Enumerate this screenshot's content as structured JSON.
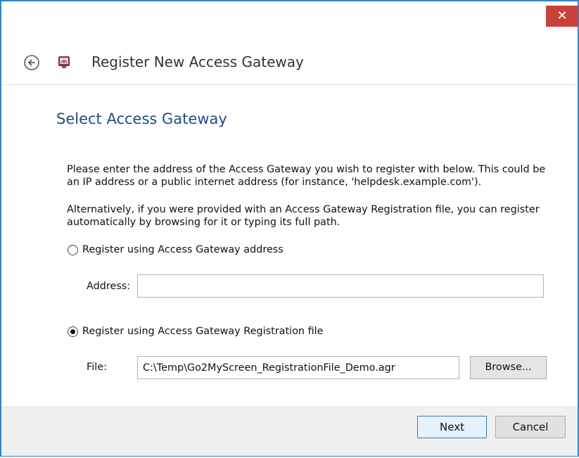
{
  "window": {
    "close_glyph": "✕",
    "title": "Register New Access Gateway",
    "back_icon": "back-arrow-icon",
    "app_icon": "access-gateway-icon"
  },
  "page": {
    "heading": "Select Access Gateway",
    "instruction_1": "Please enter the address of the Access Gateway you wish to register with below.  This could be an IP address or a public internet address (for instance, 'helpdesk.example.com').",
    "instruction_2": "Alternatively, if you were provided with an Access Gateway Registration file, you can register automatically by browsing for it or typing its full path."
  },
  "options": {
    "address_option": {
      "label": "Register using Access Gateway address",
      "selected": false,
      "field_label": "Address:",
      "value": ""
    },
    "file_option": {
      "label": "Register using Access Gateway Registration file",
      "selected": true,
      "field_label": "File:",
      "value": "C:\\Temp\\Go2MyScreen_RegistrationFile_Demo.agr",
      "browse_label": "Browse..."
    }
  },
  "footer": {
    "next_label": "Next",
    "cancel_label": "Cancel"
  },
  "colors": {
    "window_border": "#2f86c8",
    "close_button": "#c9413b",
    "heading": "#1f4e86",
    "default_button_border": "#3c7fb1"
  }
}
